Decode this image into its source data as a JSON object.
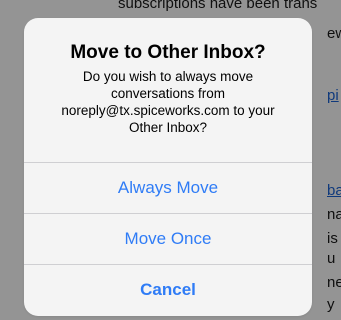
{
  "background": {
    "top_text": "subscriptions have been trans",
    "right_fragments": [
      "ew",
      "pi",
      "ba",
      "na",
      "is",
      "u",
      "ne",
      "y"
    ]
  },
  "alert": {
    "title": "Move to Other Inbox?",
    "message_lines": [
      "Do you wish to always move",
      "conversations from",
      "noreply@tx.spiceworks.com to your",
      "Other Inbox?"
    ],
    "buttons": {
      "always_move": "Always Move",
      "move_once": "Move Once",
      "cancel": "Cancel"
    }
  },
  "colors": {
    "accent": "#2f7cf6",
    "link": "#1a63d6"
  }
}
